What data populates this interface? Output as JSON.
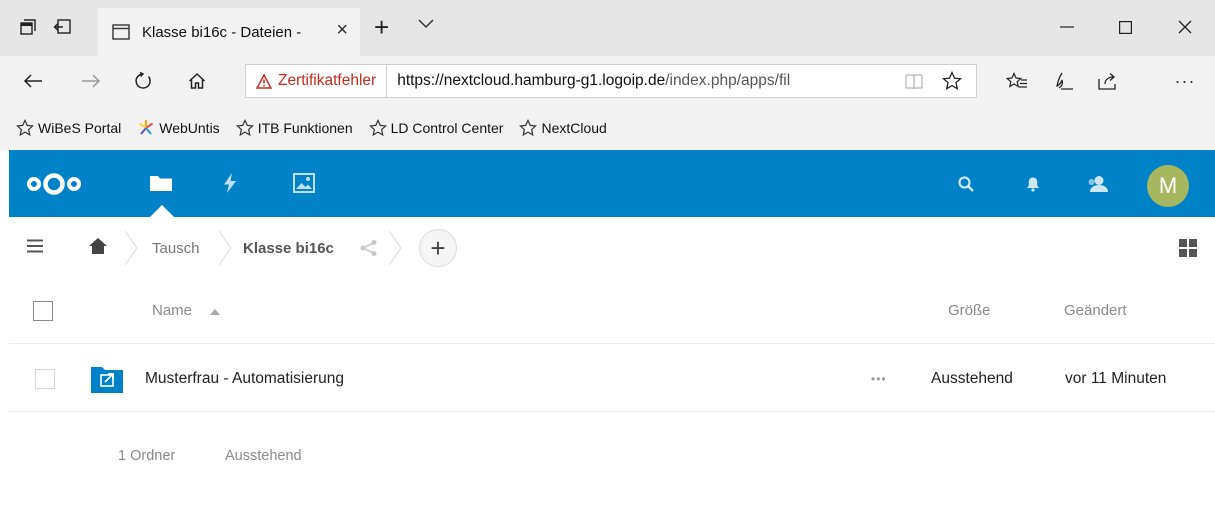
{
  "browser": {
    "tab": {
      "title": "Klasse bi16c - Dateien -",
      "close": "×"
    },
    "new_tab": "+",
    "address": {
      "cert_warning": "Zertifikatfehler",
      "url_host": "https://nextcloud.hamburg-g1.logoip.de",
      "url_path": "/index.php/apps/fil"
    },
    "more": "···",
    "bookmarks": [
      "WiBeS Portal",
      "WebUntis",
      "ITB Funktionen",
      "LD Control Center",
      "NextCloud"
    ]
  },
  "nextcloud": {
    "avatar_initial": "M",
    "accent": "#0082c9",
    "avatar_color": "#a7b75f"
  },
  "breadcrumb": {
    "parent": "Tausch",
    "current": "Klasse bi16c",
    "add": "+"
  },
  "table": {
    "columns": {
      "name": "Name",
      "size": "Größe",
      "modified": "Geändert"
    },
    "rows": [
      {
        "name": "Musterfrau - Automatisierung",
        "size": "Ausstehend",
        "modified": "vor 11 Minuten",
        "more": "•••"
      }
    ]
  },
  "summary": {
    "folders": "1 Ordner",
    "size": "Ausstehend"
  }
}
